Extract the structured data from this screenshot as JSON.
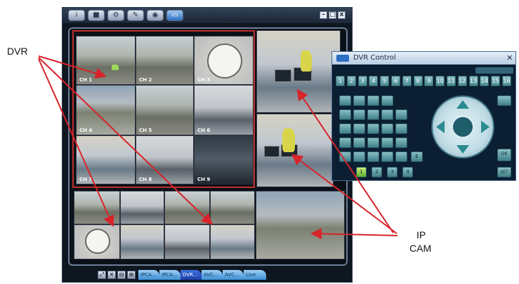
{
  "app": {
    "toolbar": [
      "i",
      "■",
      "⚙",
      "✎",
      "◉",
      "▭"
    ],
    "window_controls": [
      "–",
      "□",
      "x"
    ],
    "channels": [
      "CH 1",
      "CH 2",
      "CH 3",
      "CH 4",
      "CH 5",
      "CH 6",
      "CH 7",
      "CH 8",
      "CH 9"
    ],
    "bottom_tabs": [
      "IPCA...",
      "IPCA...",
      "DVR...",
      "AVC...",
      "AVC...",
      "Live"
    ]
  },
  "dvr_control": {
    "title": "DVR Control",
    "close": "✕",
    "channel_buttons": [
      "1",
      "2",
      "3",
      "4",
      "5",
      "6",
      "7",
      "8",
      "9",
      "10",
      "11",
      "12",
      "13",
      "14",
      "15",
      "16"
    ],
    "buttons": {
      "e": "E",
      "ok": "OK",
      "set": "SET"
    },
    "footer_buttons": [
      "1",
      "2",
      "3",
      "4"
    ]
  },
  "annotations": {
    "dvr_label": "DVR",
    "ip_label": "IP",
    "cam_label": "CAM"
  },
  "colors": {
    "accent_red": "#d8232a",
    "selected_tab": "#1d3fa8",
    "panel_teal": "#4a8a93"
  }
}
